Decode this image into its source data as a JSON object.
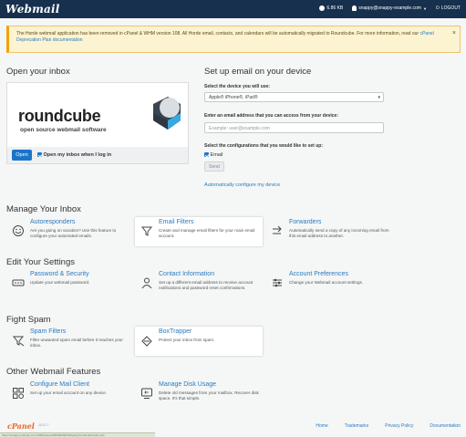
{
  "topbar": {
    "logo": "Webmail",
    "disk": "6.86 KB",
    "user": "snappy@snappy-example.com",
    "logout": "LOGOUT"
  },
  "notice": {
    "text": "The Horde webmail application has been removed in cPanel & WHM version 108. All Horde email, contacts, and calendars will be automatically migrated to Roundcube. For more information, read our ",
    "link": "cPanel Deprecation Plan documentation",
    "close": "×"
  },
  "open_inbox": {
    "heading": "Open your inbox",
    "logo_word": "roundcube",
    "logo_sub": "open source webmail software",
    "open_label": "Open",
    "remember_label": "Open my inbox when I log in"
  },
  "setup": {
    "heading": "Set up email on your device",
    "device_label": "Select the device you will use:",
    "device_value": "Apple® iPhone®, iPad®",
    "email_label": "Enter an email address that you can access from your device:",
    "email_placeholder": "Example: user@example.com",
    "config_label": "Select the configurations that you would like to set up:",
    "config_email": "Email",
    "send_label": "Send",
    "auto_link": "Automatically configure my device"
  },
  "sections": {
    "manage": "Manage Your Inbox",
    "settings": "Edit Your Settings",
    "spam": "Fight Spam",
    "other": "Other Webmail Features"
  },
  "cards": {
    "autoresponders": {
      "title": "Autoresponders",
      "desc": "Are you going on vacation? Use this feature to configure your automated emails.",
      "icon": "autoresponder-icon"
    },
    "filters": {
      "title": "Email Filters",
      "desc": "Create and manage email filters for your main email account.",
      "icon": "filter-icon"
    },
    "forwarders": {
      "title": "Forwarders",
      "desc": "Automatically send a copy of any incoming email from this email address to another.",
      "icon": "forward-icon"
    },
    "password": {
      "title": "Password & Security",
      "desc": "Update your webmail password.",
      "icon": "password-icon"
    },
    "contact": {
      "title": "Contact Information",
      "desc": "Set up a different email address to receive account notifications and password reset confirmations.",
      "icon": "contact-icon"
    },
    "prefs": {
      "title": "Account Preferences",
      "desc": "Change your Webmail account settings.",
      "icon": "sliders-icon"
    },
    "spam_filters": {
      "title": "Spam Filters",
      "desc": "Filter unwanted spam email before it reaches your inbox.",
      "icon": "spam-filter-icon"
    },
    "boxtrapper": {
      "title": "BoxTrapper",
      "desc": "Protect your inbox from spam.",
      "icon": "boxtrapper-icon"
    },
    "mail_client": {
      "title": "Configure Mail Client",
      "desc": "Set up your email account on any device.",
      "icon": "mail-client-icon"
    },
    "disk": {
      "title": "Manage Disk Usage",
      "desc": "Delete old messages from your mailbox. Recover disk space. It's that simple.",
      "icon": "disk-usage-icon"
    }
  },
  "footer": {
    "logo": "cPanel",
    "version": "110.0.7",
    "links": [
      "Home",
      "Trademarks",
      "Privacy Policy",
      "Documentation"
    ]
  },
  "statusbar": "https://snappy-example.com:2096/cpsess0000000000/3rdparty/roundcube/index.php",
  "colors": {
    "topbar": "#16304e",
    "link": "#2a7bbf",
    "primary": "#1a75c9",
    "cpanel": "#e9672c"
  }
}
